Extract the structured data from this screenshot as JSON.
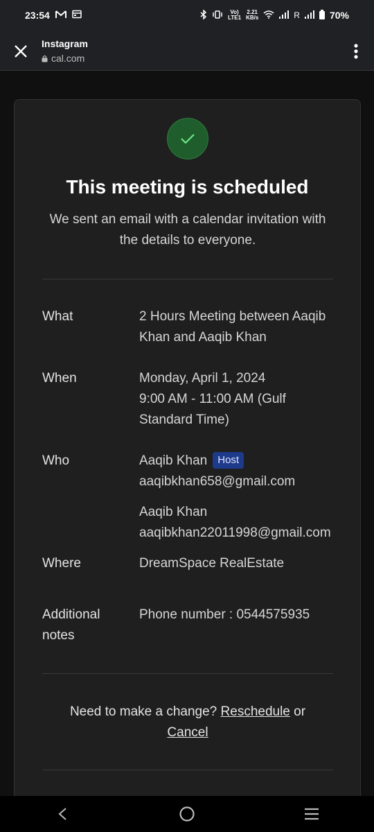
{
  "status_bar": {
    "time": "23:54",
    "net_speed_top": "2.21",
    "net_speed_bottom": "KB/s",
    "volte_top": "Vo)",
    "volte_bottom": "LTE1",
    "roaming": "R",
    "battery": "70%"
  },
  "browser": {
    "title": "Instagram",
    "url": "cal.com"
  },
  "confirmation": {
    "title": "This meeting is scheduled",
    "subtitle": "We sent an email with a calendar invitation with the details to everyone.",
    "what_label": "What",
    "what_value": "2 Hours Meeting between Aaqib Khan and Aaqib Khan",
    "when_label": "When",
    "when_date": "Monday, April 1, 2024",
    "when_time": "9:00 AM - 11:00 AM (Gulf Standard Time)",
    "who_label": "Who",
    "host_name": "Aaqib Khan",
    "host_badge": "Host",
    "host_email": "aaqibkhan658@gmail.com",
    "attendee_name": "Aaqib Khan",
    "attendee_email": "aaqibkhan22011998@gmail.com",
    "where_label": "Where",
    "where_value": "DreamSpace RealEstate",
    "notes_label": "Additional notes",
    "notes_value": "Phone number : 0544575935",
    "change_prompt": "Need to make a change?",
    "reschedule_label": "Reschedule",
    "or_text": "or",
    "cancel_label": "Cancel"
  },
  "colors": {
    "background": "#101010",
    "card": "#1f1f1f",
    "success": "#1f5e2c",
    "check": "#6ee787",
    "host_badge": "#1e3a8a"
  }
}
